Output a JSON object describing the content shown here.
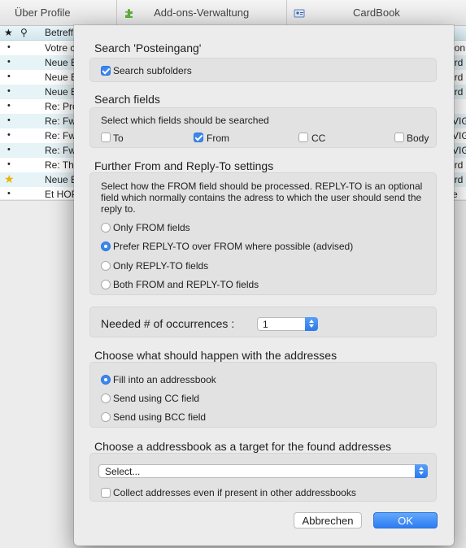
{
  "tabs": [
    {
      "label": "Über Profile"
    },
    {
      "label": "Add-ons-Verwaltung",
      "icon": "puzzle-piece-icon"
    },
    {
      "label": "CardBook",
      "icon": "address-card-icon"
    }
  ],
  "message_list": {
    "header": {
      "star": "★",
      "attachment": "⚲",
      "subject": "Betreff"
    },
    "rows": [
      {
        "marker": "•",
        "subject": "Votre co",
        "tail": "ion"
      },
      {
        "marker": "•",
        "subject": "Neue B",
        "tail": "ird"
      },
      {
        "marker": "•",
        "subject": "Neue B",
        "tail": "ird"
      },
      {
        "marker": "•",
        "subject": "Neue B",
        "tail": "ird"
      },
      {
        "marker": "•",
        "subject": "Re: Pro",
        "tail": ""
      },
      {
        "marker": "•",
        "subject": "Re: Fw",
        "tail": "VIG"
      },
      {
        "marker": "•",
        "subject": "Re: Fw",
        "tail": "VIG"
      },
      {
        "marker": "•",
        "subject": "Re: Fw",
        "tail": "VIG"
      },
      {
        "marker": "•",
        "subject": "Re: Thu",
        "tail": "ird"
      },
      {
        "marker": "★",
        "subject": "Neue B",
        "tail": "ird"
      },
      {
        "marker": "•",
        "subject": "Et HOP",
        "tail": "e"
      }
    ]
  },
  "dialog": {
    "search_section": {
      "title": "Search 'Posteingang'",
      "subfolders_label": "Search subfolders",
      "subfolders_checked": true
    },
    "fields_section": {
      "title": "Search fields",
      "description": "Select which fields should be searched",
      "fields": [
        {
          "label": "To",
          "checked": false
        },
        {
          "label": "From",
          "checked": true
        },
        {
          "label": "CC",
          "checked": false
        },
        {
          "label": "Body",
          "checked": false
        }
      ]
    },
    "reply_section": {
      "title": "Further From and Reply-To settings",
      "description": "Select how the FROM field should be processed. REPLY-TO is an optional field which normally contains the adress to which the user should send the reply to.",
      "options": [
        {
          "label": "Only FROM fields",
          "selected": false
        },
        {
          "label": "Prefer REPLY-TO over FROM where possible (advised)",
          "selected": true
        },
        {
          "label": "Only REPLY-TO fields",
          "selected": false
        },
        {
          "label": "Both FROM and REPLY-TO fields",
          "selected": false
        }
      ]
    },
    "occurrences": {
      "label": "Needed # of occurrences :",
      "value": "1"
    },
    "addresses_section": {
      "title": "Choose what should happen with the addresses",
      "options": [
        {
          "label": "Fill into an addressbook",
          "selected": true
        },
        {
          "label": "Send using CC field",
          "selected": false
        },
        {
          "label": "Send using BCC field",
          "selected": false
        }
      ]
    },
    "addressbook_section": {
      "title": "Choose a addressbook as a target for the found addresses",
      "select_value": "Select...",
      "collect_label": "Collect addresses even if present in other addressbooks",
      "collect_checked": false
    },
    "buttons": {
      "cancel": "Abbrechen",
      "ok": "OK"
    }
  },
  "colors": {
    "accent": "#3b87f0",
    "list_alt_row": "#e6f3f7",
    "dialog_bg": "#ececec",
    "group_bg": "#e2e2e2"
  }
}
